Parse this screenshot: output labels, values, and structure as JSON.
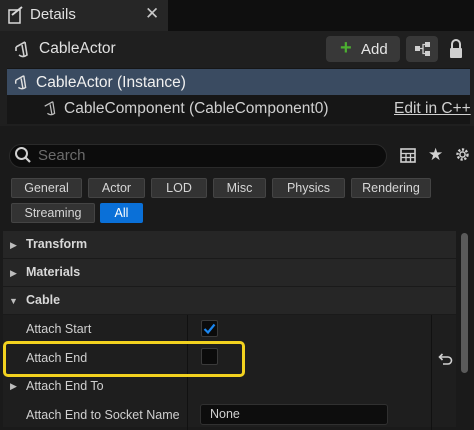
{
  "tab": {
    "title": "Details",
    "close": "✕"
  },
  "header": {
    "actor_name": "CableActor",
    "add_label": "Add",
    "add_plus": "+"
  },
  "tree": {
    "instance_label": "CableActor (Instance)",
    "component_label": "CableComponent (CableComponent0)",
    "edit_link": "Edit in C++"
  },
  "search": {
    "placeholder": "Search"
  },
  "filters": [
    {
      "label": "General",
      "active": false
    },
    {
      "label": "Actor",
      "active": false
    },
    {
      "label": "LOD",
      "active": false
    },
    {
      "label": "Misc",
      "active": false
    },
    {
      "label": "Physics",
      "active": false
    },
    {
      "label": "Rendering",
      "active": false
    },
    {
      "label": "Streaming",
      "active": false
    },
    {
      "label": "All",
      "active": true
    }
  ],
  "categories": {
    "transform": "Transform",
    "materials": "Materials",
    "cable": "Cable"
  },
  "properties": {
    "attach_start": {
      "label": "Attach Start",
      "checked": true
    },
    "attach_end": {
      "label": "Attach End",
      "checked": false
    },
    "attach_end_to": {
      "label": "Attach End To"
    },
    "attach_end_socket": {
      "label": "Attach End to Socket Name",
      "value": "None"
    }
  },
  "colors": {
    "accent": "#0a70d8",
    "highlight": "#f2d21f",
    "add_plus": "#4caf31",
    "selection": "#3a4b61"
  }
}
